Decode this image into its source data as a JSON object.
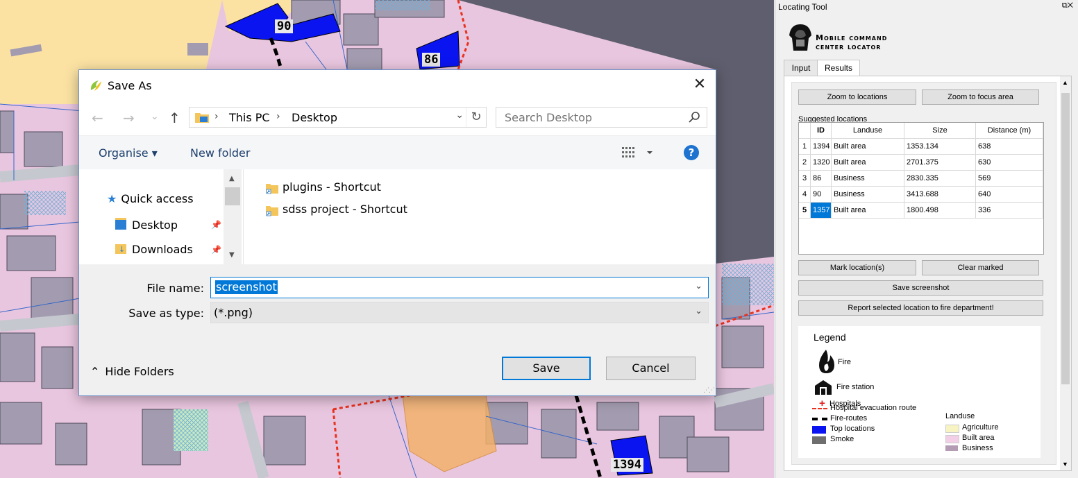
{
  "map": {
    "labels": [
      "90",
      "86",
      "1394"
    ]
  },
  "dialog": {
    "title": "Save As",
    "close": "✕",
    "nav": {
      "back": "←",
      "forward": "→",
      "recent": "⌄",
      "up": "↑"
    },
    "breadcrumb": [
      "This PC",
      "Desktop"
    ],
    "search_placeholder": "Search Desktop",
    "toolbar": {
      "organise": "Organise ▾",
      "new_folder": "New folder",
      "help": "?"
    },
    "sidebar": {
      "quick_access": "Quick access",
      "items": [
        {
          "label": "Desktop"
        },
        {
          "label": "Downloads"
        }
      ]
    },
    "files": [
      "plugins - Shortcut",
      "sdss project - Shortcut"
    ],
    "file_name_label": "File name:",
    "file_name_value": "screenshot",
    "save_type_label": "Save as type:",
    "save_type_value": "(*.png)",
    "hide_folders": "Hide Folders",
    "save": "Save",
    "cancel": "Cancel"
  },
  "panel": {
    "title": "Locating Tool",
    "logo_line1": "Mobile command",
    "logo_line2": "center locator",
    "tabs": [
      "Input",
      "Results"
    ],
    "active_tab": "Results",
    "buttons": {
      "zoom_locations": "Zoom to locations",
      "zoom_focus": "Zoom to focus area",
      "mark": "Mark location(s)",
      "clear": "Clear marked",
      "save_screenshot": "Save screenshot",
      "report": "Report selected location to fire department!"
    },
    "suggested_label": "Suggested locations",
    "table": {
      "headers": [
        "ID",
        "Landuse",
        "Size",
        "Distance (m)"
      ],
      "rows": [
        {
          "n": "1",
          "id": "1394",
          "landuse": "Built area",
          "size": "1353.134",
          "distance": "638"
        },
        {
          "n": "2",
          "id": "1320",
          "landuse": "Built area",
          "size": "2701.375",
          "distance": "630"
        },
        {
          "n": "3",
          "id": "86",
          "landuse": "Business",
          "size": "2830.335",
          "distance": "569"
        },
        {
          "n": "4",
          "id": "90",
          "landuse": "Business",
          "size": "3413.688",
          "distance": "640"
        },
        {
          "n": "5",
          "id": "1357",
          "landuse": "Built area",
          "size": "1800.498",
          "distance": "336"
        }
      ],
      "selected_row": 5
    },
    "legend": {
      "title": "Legend",
      "fire": "Fire",
      "fire_station": "Fire station",
      "hospitals": "Hospitals",
      "evac": "Hospital evacuation route",
      "fire_routes": "Fire-routes",
      "top": "Top locations",
      "smoke": "Smoke",
      "landuse_title": "Landuse",
      "agri": "Agriculture",
      "built": "Built area",
      "business": "Business"
    },
    "colors": {
      "selection": "#0078d7",
      "top_locations": "#0a14f0",
      "evac_route": "#e8321e"
    }
  }
}
